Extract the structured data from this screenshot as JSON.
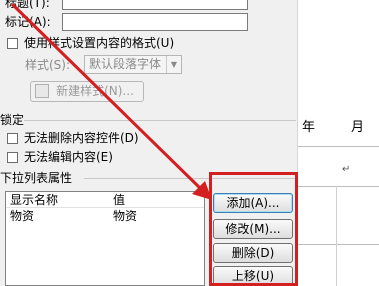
{
  "form": {
    "title_label": "标题(T):",
    "tag_label": "标记(A):",
    "use_style_label": "使用样式设置内容的格式(U)",
    "style_label": "样式(S):",
    "style_value": "默认段落字体",
    "new_style_button": "新建样式(N)..."
  },
  "locking": {
    "section_label": "锁定",
    "no_delete_label": "无法删除内容控件(D)",
    "no_edit_label": "无法编辑内容(E)"
  },
  "dropdown": {
    "section_label": "下拉列表属性",
    "col_display": "显示名称",
    "col_value": "值",
    "rows": [
      {
        "display": "物资",
        "value": "物资"
      }
    ]
  },
  "buttons": {
    "add": "添加(A)...",
    "modify": "修改(M)...",
    "delete": "删除(D)",
    "move_up": "上移(U)"
  },
  "document": {
    "header_month": "月",
    "header_fragment": "年",
    "paragraph_mark": "↵"
  },
  "colors": {
    "annotation_red": "#d31f1f"
  }
}
